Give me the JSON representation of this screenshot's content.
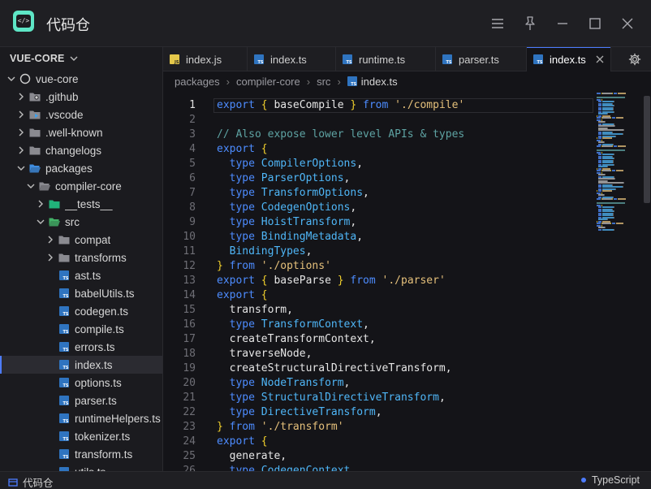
{
  "app": {
    "title": "代码仓",
    "logo_text": "</>"
  },
  "window_controls": {
    "icons": [
      "menu-icon",
      "pin-icon",
      "minimize-icon",
      "maximize-icon",
      "close-icon"
    ]
  },
  "sidebar": {
    "header": "VUE-CORE",
    "items": [
      {
        "label": "vue-core",
        "depth": 0,
        "kind": "root",
        "expanded": true
      },
      {
        "label": ".github",
        "depth": 1,
        "kind": "folder-github",
        "expanded": false
      },
      {
        "label": ".vscode",
        "depth": 1,
        "kind": "folder-vscode",
        "expanded": false
      },
      {
        "label": ".well-known",
        "depth": 1,
        "kind": "folder",
        "expanded": false
      },
      {
        "label": "changelogs",
        "depth": 1,
        "kind": "folder",
        "expanded": false
      },
      {
        "label": "packages",
        "depth": 1,
        "kind": "folder-packages",
        "expanded": true
      },
      {
        "label": "compiler-core",
        "depth": 2,
        "kind": "folder-open",
        "expanded": true
      },
      {
        "label": "__tests__",
        "depth": 3,
        "kind": "folder-tests",
        "expanded": false
      },
      {
        "label": "src",
        "depth": 3,
        "kind": "folder-src",
        "expanded": true
      },
      {
        "label": "compat",
        "depth": 4,
        "kind": "folder",
        "expanded": false
      },
      {
        "label": "transforms",
        "depth": 4,
        "kind": "folder",
        "expanded": false
      },
      {
        "label": "ast.ts",
        "depth": 4,
        "kind": "ts"
      },
      {
        "label": "babelUtils.ts",
        "depth": 4,
        "kind": "ts"
      },
      {
        "label": "codegen.ts",
        "depth": 4,
        "kind": "ts"
      },
      {
        "label": "compile.ts",
        "depth": 4,
        "kind": "ts"
      },
      {
        "label": "errors.ts",
        "depth": 4,
        "kind": "ts"
      },
      {
        "label": "index.ts",
        "depth": 4,
        "kind": "ts",
        "selected": true
      },
      {
        "label": "options.ts",
        "depth": 4,
        "kind": "ts"
      },
      {
        "label": "parser.ts",
        "depth": 4,
        "kind": "ts"
      },
      {
        "label": "runtimeHelpers.ts",
        "depth": 4,
        "kind": "ts"
      },
      {
        "label": "tokenizer.ts",
        "depth": 4,
        "kind": "ts"
      },
      {
        "label": "transform.ts",
        "depth": 4,
        "kind": "ts"
      },
      {
        "label": "utils.ts",
        "depth": 4,
        "kind": "ts"
      }
    ]
  },
  "tabs": [
    {
      "label": "index.js",
      "kind": "js",
      "width": 104
    },
    {
      "label": "index.ts",
      "kind": "ts",
      "width": 109
    },
    {
      "label": "runtime.ts",
      "kind": "ts",
      "width": 123
    },
    {
      "label": "parser.ts",
      "kind": "ts",
      "width": 112
    },
    {
      "label": "index.ts",
      "kind": "ts",
      "width": 104,
      "active": true
    }
  ],
  "breadcrumb": [
    "packages",
    "compiler-core",
    "src",
    "index.ts"
  ],
  "editor": {
    "current_line": 1,
    "lines": [
      [
        [
          "k",
          "export"
        ],
        [
          "p",
          " "
        ],
        [
          "b1",
          "{"
        ],
        [
          "i",
          " baseCompile "
        ],
        [
          "b1",
          "}"
        ],
        [
          "p",
          " "
        ],
        [
          "k",
          "from"
        ],
        [
          "p",
          " "
        ],
        [
          "s",
          "'./compile'"
        ]
      ],
      [],
      [
        [
          "c",
          "// Also expose lower level APIs & types"
        ]
      ],
      [
        [
          "k",
          "export"
        ],
        [
          "p",
          " "
        ],
        [
          "b1",
          "{"
        ]
      ],
      [
        [
          "p",
          "  "
        ],
        [
          "k",
          "type"
        ],
        [
          "p",
          " "
        ],
        [
          "t",
          "CompilerOptions"
        ],
        [
          "p",
          ","
        ]
      ],
      [
        [
          "p",
          "  "
        ],
        [
          "k",
          "type"
        ],
        [
          "p",
          " "
        ],
        [
          "t",
          "ParserOptions"
        ],
        [
          "p",
          ","
        ]
      ],
      [
        [
          "p",
          "  "
        ],
        [
          "k",
          "type"
        ],
        [
          "p",
          " "
        ],
        [
          "t",
          "TransformOptions"
        ],
        [
          "p",
          ","
        ]
      ],
      [
        [
          "p",
          "  "
        ],
        [
          "k",
          "type"
        ],
        [
          "p",
          " "
        ],
        [
          "t",
          "CodegenOptions"
        ],
        [
          "p",
          ","
        ]
      ],
      [
        [
          "p",
          "  "
        ],
        [
          "k",
          "type"
        ],
        [
          "p",
          " "
        ],
        [
          "t",
          "HoistTransform"
        ],
        [
          "p",
          ","
        ]
      ],
      [
        [
          "p",
          "  "
        ],
        [
          "k",
          "type"
        ],
        [
          "p",
          " "
        ],
        [
          "t",
          "BindingMetadata"
        ],
        [
          "p",
          ","
        ]
      ],
      [
        [
          "p",
          "  "
        ],
        [
          "t",
          "BindingTypes"
        ],
        [
          "p",
          ","
        ]
      ],
      [
        [
          "b1",
          "}"
        ],
        [
          "p",
          " "
        ],
        [
          "k",
          "from"
        ],
        [
          "p",
          " "
        ],
        [
          "s",
          "'./options'"
        ]
      ],
      [
        [
          "k",
          "export"
        ],
        [
          "p",
          " "
        ],
        [
          "b1",
          "{"
        ],
        [
          "i",
          " baseParse "
        ],
        [
          "b1",
          "}"
        ],
        [
          "p",
          " "
        ],
        [
          "k",
          "from"
        ],
        [
          "p",
          " "
        ],
        [
          "s",
          "'./parser'"
        ]
      ],
      [
        [
          "k",
          "export"
        ],
        [
          "p",
          " "
        ],
        [
          "b1",
          "{"
        ]
      ],
      [
        [
          "p",
          "  "
        ],
        [
          "i",
          "transform"
        ],
        [
          "p",
          ","
        ]
      ],
      [
        [
          "p",
          "  "
        ],
        [
          "k",
          "type"
        ],
        [
          "p",
          " "
        ],
        [
          "t",
          "TransformContext"
        ],
        [
          "p",
          ","
        ]
      ],
      [
        [
          "p",
          "  "
        ],
        [
          "i",
          "createTransformContext"
        ],
        [
          "p",
          ","
        ]
      ],
      [
        [
          "p",
          "  "
        ],
        [
          "i",
          "traverseNode"
        ],
        [
          "p",
          ","
        ]
      ],
      [
        [
          "p",
          "  "
        ],
        [
          "i",
          "createStructuralDirectiveTransform"
        ],
        [
          "p",
          ","
        ]
      ],
      [
        [
          "p",
          "  "
        ],
        [
          "k",
          "type"
        ],
        [
          "p",
          " "
        ],
        [
          "t",
          "NodeTransform"
        ],
        [
          "p",
          ","
        ]
      ],
      [
        [
          "p",
          "  "
        ],
        [
          "k",
          "type"
        ],
        [
          "p",
          " "
        ],
        [
          "t",
          "StructuralDirectiveTransform"
        ],
        [
          "p",
          ","
        ]
      ],
      [
        [
          "p",
          "  "
        ],
        [
          "k",
          "type"
        ],
        [
          "p",
          " "
        ],
        [
          "t",
          "DirectiveTransform"
        ],
        [
          "p",
          ","
        ]
      ],
      [
        [
          "b1",
          "}"
        ],
        [
          "p",
          " "
        ],
        [
          "k",
          "from"
        ],
        [
          "p",
          " "
        ],
        [
          "s",
          "'./transform'"
        ]
      ],
      [
        [
          "k",
          "export"
        ],
        [
          "p",
          " "
        ],
        [
          "b1",
          "{"
        ]
      ],
      [
        [
          "p",
          "  "
        ],
        [
          "i",
          "generate"
        ],
        [
          "p",
          ","
        ]
      ],
      [
        [
          "p",
          "  "
        ],
        [
          "k",
          "type"
        ],
        [
          "p",
          " "
        ],
        [
          "t",
          "CodegenContext"
        ],
        [
          "p",
          ","
        ]
      ]
    ]
  },
  "statusbar": {
    "left_label": "代码仓",
    "language": "TypeScript"
  },
  "colors": {
    "accent": "#4d7cff",
    "keyword": "#4d8cff",
    "type": "#4fb6f7",
    "string": "#e5c07b",
    "comment": "#5ea3a3"
  }
}
